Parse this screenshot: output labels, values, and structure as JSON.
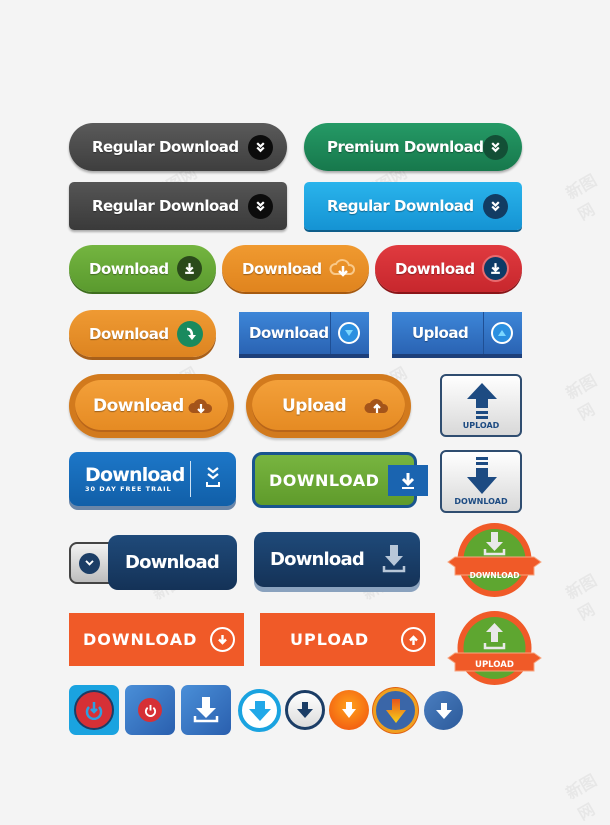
{
  "colors": {
    "background": "#f4f4f4",
    "dark_gray": "#4a4a4a",
    "green": "#1e8a5a",
    "sky_blue": "#1aa3e0",
    "lime_green": "#6aaa3a",
    "orange": "#e8912a",
    "red": "#d63036",
    "blue": "#2f6fc0",
    "navy": "#1b3d66",
    "flat_orange": "#f05a28"
  },
  "watermark": "新图网",
  "buttons": {
    "regular_download_dark_pill": {
      "label": "Regular Download",
      "icon": "double-chevron-down-icon"
    },
    "premium_download_green": {
      "label": "Premium Download",
      "icon": "double-chevron-down-icon"
    },
    "regular_download_dark_rect": {
      "label": "Regular Download",
      "icon": "double-chevron-down-icon"
    },
    "regular_download_blue": {
      "label": "Regular Download",
      "icon": "double-chevron-down-icon"
    },
    "download_green_pill": {
      "label": "Download",
      "icon": "download-tray-icon"
    },
    "download_orange_cloud": {
      "label": "Download",
      "icon": "cloud-download-icon"
    },
    "download_red_pill": {
      "label": "Download",
      "icon": "download-tray-icon"
    },
    "download_orange_curved": {
      "label": "Download",
      "icon": "curved-arrow-down-icon"
    },
    "download_blue_split": {
      "label": "Download",
      "icon": "circle-chevron-down-icon"
    },
    "upload_blue_split": {
      "label": "Upload",
      "icon": "circle-chevron-up-icon"
    },
    "download_orange_large": {
      "label": "Download",
      "icon": "cloud-download-icon"
    },
    "upload_orange_large": {
      "label": "Upload",
      "icon": "cloud-upload-icon"
    },
    "upload_tile": {
      "label": "UPLOAD",
      "icon": "arrow-up-icon"
    },
    "download_trial": {
      "label": "Download",
      "sublabel": "30 DAY FREE TRAIL",
      "icon": "double-chevron-down-tray-icon"
    },
    "download_green_tab": {
      "label": "DOWNLOAD",
      "icon": "download-tray-icon"
    },
    "download_tile": {
      "label": "DOWNLOAD",
      "icon": "arrow-down-icon"
    },
    "download_navy_toggle": {
      "label": "Download",
      "icon": "circle-chevron-down-icon"
    },
    "download_navy_3d": {
      "label": "Download",
      "icon": "download-tray-icon"
    },
    "download_badge": {
      "label": "DOWNLOAD",
      "icon": "download-tray-icon"
    },
    "download_flat_orange": {
      "label": "DOWNLOAD",
      "icon": "circle-arrow-down-icon"
    },
    "upload_flat_orange": {
      "label": "UPLOAD",
      "icon": "circle-arrow-up-icon"
    },
    "upload_badge": {
      "label": "UPLOAD",
      "icon": "upload-tray-icon"
    }
  },
  "icon_buttons": [
    {
      "name": "red-power-download-square",
      "icon": "circle-arrow-down-icon"
    },
    {
      "name": "red-power-square-blue",
      "icon": "power-icon"
    },
    {
      "name": "blue-download-tray-square",
      "icon": "download-tray-icon"
    },
    {
      "name": "light-blue-ring-download",
      "icon": "arrow-down-icon"
    },
    {
      "name": "navy-ring-download",
      "icon": "arrow-down-icon"
    },
    {
      "name": "orange-circle-download",
      "icon": "arrow-down-icon"
    },
    {
      "name": "blue-gold-circle-download",
      "icon": "arrow-down-icon"
    },
    {
      "name": "blue-circle-download",
      "icon": "arrow-down-icon"
    }
  ]
}
